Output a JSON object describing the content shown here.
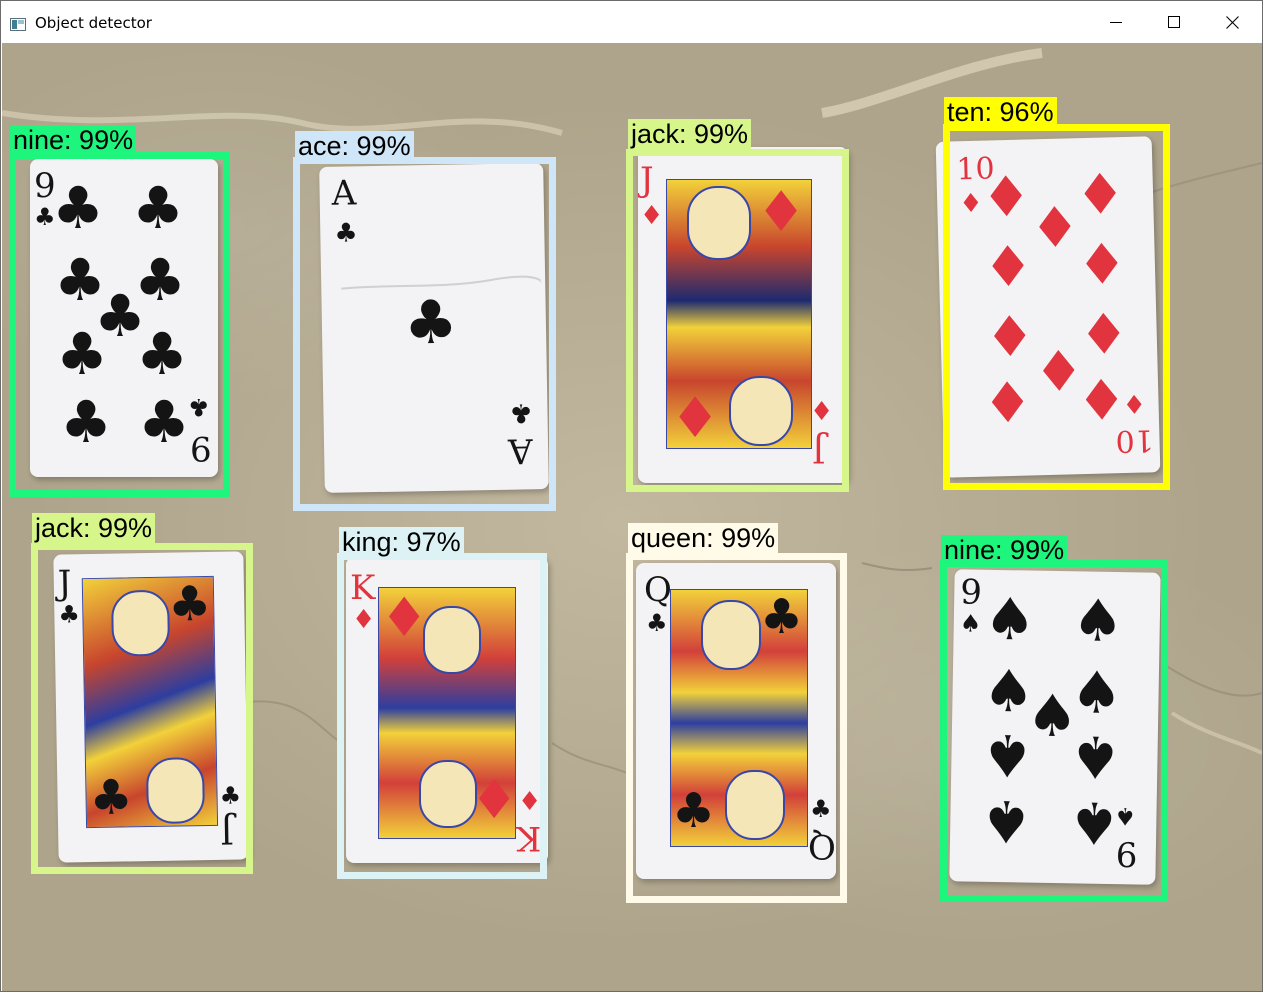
{
  "window": {
    "title": "Object detector",
    "icon": "app-window-icon",
    "controls": [
      "minimize-icon",
      "maximize-icon",
      "close-icon"
    ]
  },
  "detections": [
    {
      "label": "nine",
      "score": "99%",
      "text": "nine: 99%",
      "color": "#1ef57d",
      "suit": "clubs"
    },
    {
      "label": "ace",
      "score": "99%",
      "text": "ace: 99%",
      "color": "#cfe6f8",
      "suit": "clubs"
    },
    {
      "label": "jack",
      "score": "99%",
      "text": "jack: 99%",
      "color": "#d6f58a",
      "suit": "diamonds"
    },
    {
      "label": "ten",
      "score": "96%",
      "text": "ten: 96%",
      "color": "#ffff00",
      "suit": "diamonds"
    },
    {
      "label": "jack",
      "score": "99%",
      "text": "jack: 99%",
      "color": "#d6f58a",
      "suit": "clubs"
    },
    {
      "label": "king",
      "score": "97%",
      "text": "king: 97%",
      "color": "#dcf2f5",
      "suit": "diamonds"
    },
    {
      "label": "queen",
      "score": "99%",
      "text": "queen: 99%",
      "color": "#fffbe8",
      "suit": "clubs"
    },
    {
      "label": "nine",
      "score": "99%",
      "text": "nine: 99%",
      "color": "#1ef57d",
      "suit": "spades"
    }
  ],
  "cards": {
    "nine_clubs": {
      "rank": "9",
      "suit": "♣"
    },
    "ace_clubs": {
      "rank": "A",
      "suit": "♣"
    },
    "jack_diamonds": {
      "rank": "J",
      "suit": "♦"
    },
    "ten_diamonds": {
      "rank": "10",
      "suit": "♦"
    },
    "jack_clubs": {
      "rank": "J",
      "suit": "♣"
    },
    "king_diamonds": {
      "rank": "K",
      "suit": "♦"
    },
    "queen_clubs": {
      "rank": "Q",
      "suit": "♣"
    },
    "nine_spades": {
      "rank": "9",
      "suit": "♠"
    }
  }
}
